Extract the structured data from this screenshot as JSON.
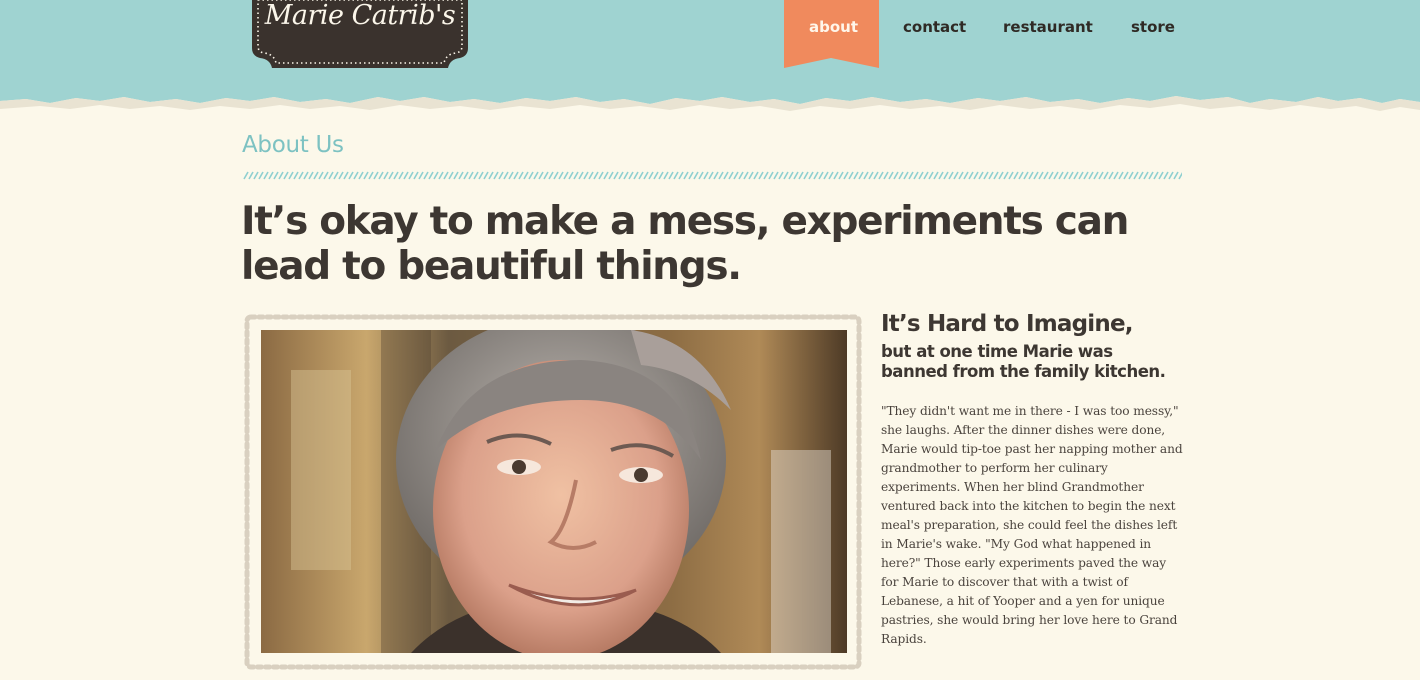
{
  "brand": {
    "logo_text": "Marie Catrib's"
  },
  "nav": {
    "items": [
      {
        "label": "about",
        "active": true
      },
      {
        "label": "contact",
        "active": false
      },
      {
        "label": "restaurant",
        "active": false
      },
      {
        "label": "store",
        "active": false
      }
    ]
  },
  "main": {
    "section_title": "About Us",
    "tagline": "It’s okay to make a mess, experiments can lead to beautiful things.",
    "story": {
      "title": "It’s Hard to Imagine,",
      "subtitle": "but at one time Marie was banned from the family kitchen.",
      "body": "\"They didn't want me in there - I was too messy,\" she laughs. After the dinner dishes were done, Marie would tip-toe past her napping mother and grandmother to perform her culinary experiments. When her blind Grandmother ventured back into the kitchen to begin the next meal's preparation, she could feel the dishes left in Marie's wake. \"My God what happened in here?\" Those early experiments paved the way for Marie to discover that with a twist of Lebanese, a hit of Yooper and a yen for unique pastries, she would bring her love here to Grand Rapids."
    }
  },
  "colors": {
    "header_teal": "#9fd3d1",
    "page_cream": "#fcf8ea",
    "accent_orange": "#f08a5d",
    "heading_teal": "#7dc2c2",
    "text_dark": "#3d3732",
    "logo_dark": "#3a322d"
  },
  "icons": {
    "nav_active_marker": "ribbon-bookmark",
    "photo_border": "dotted-stitch-frame"
  }
}
